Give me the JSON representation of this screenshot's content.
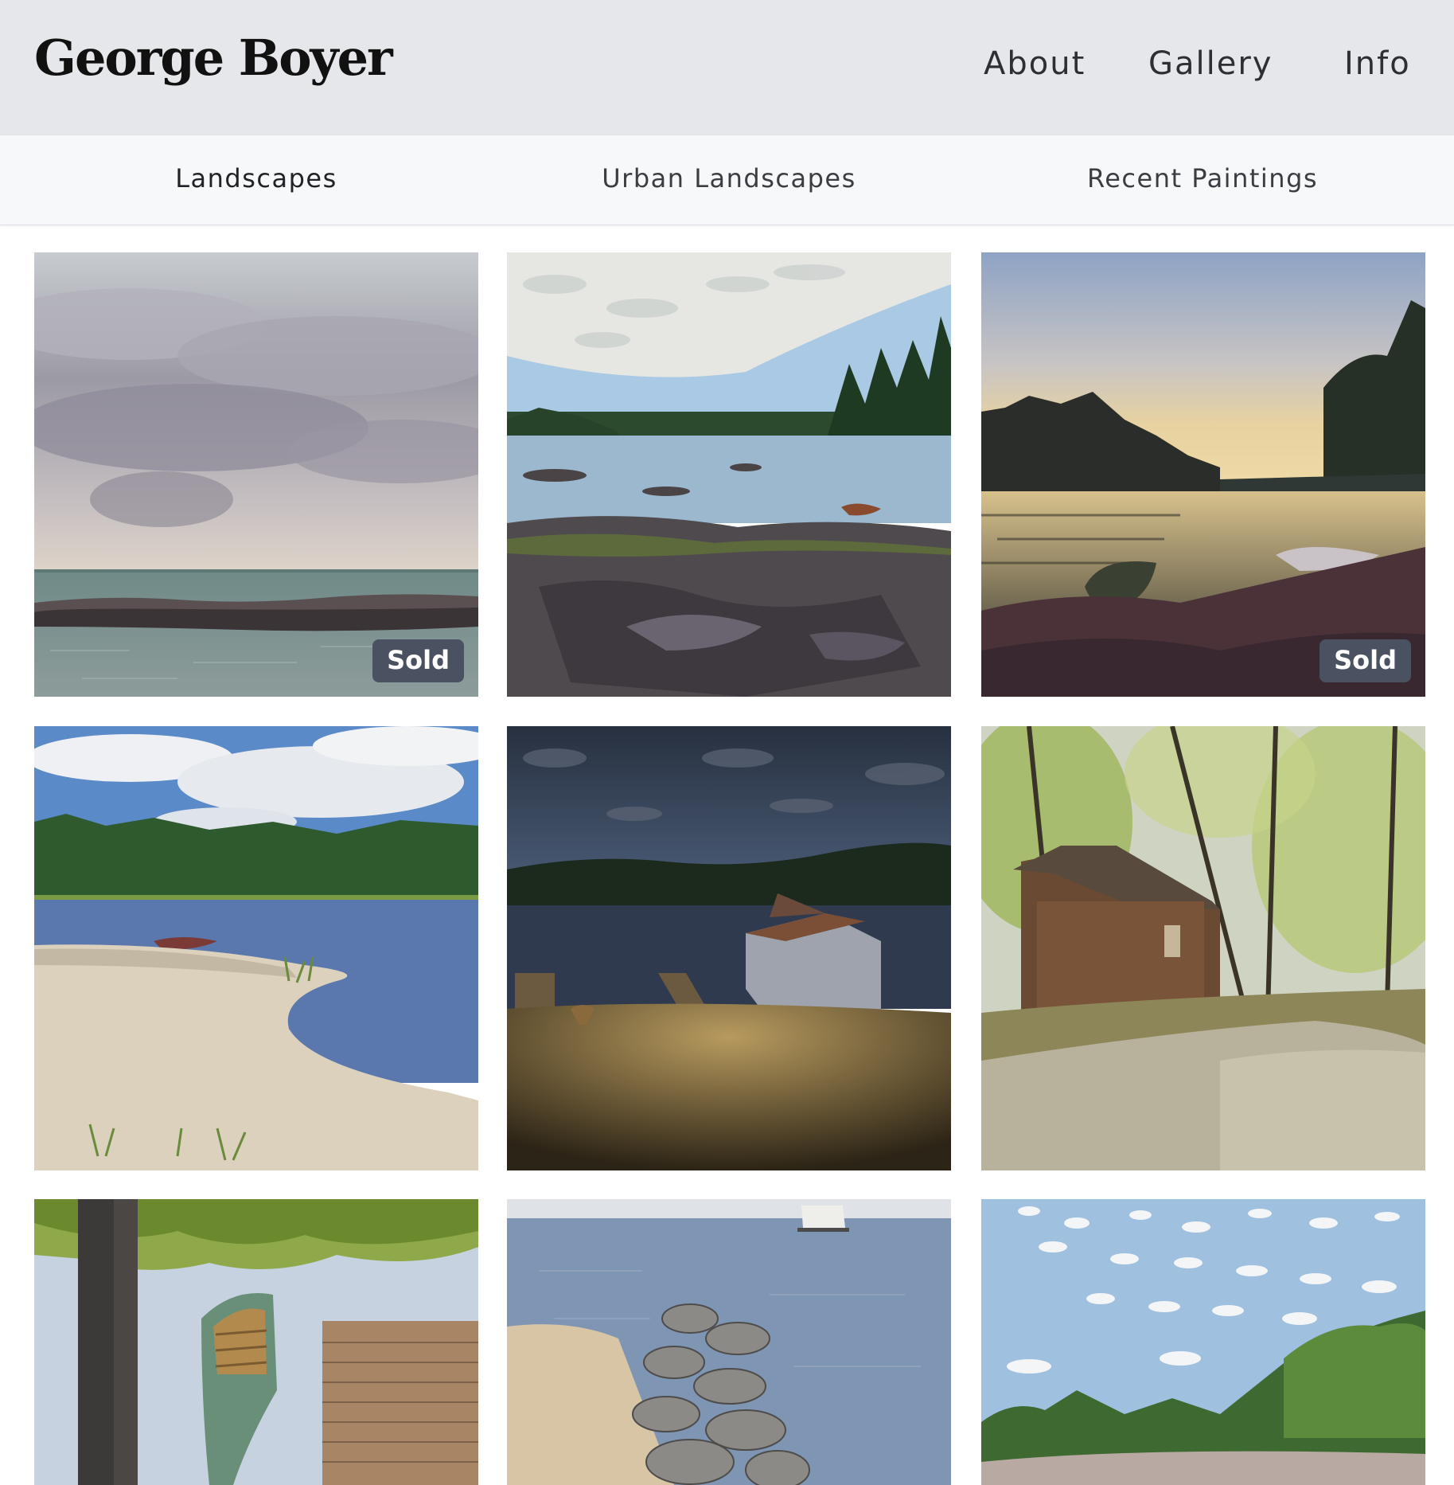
{
  "header": {
    "site_title": "George Boyer",
    "nav": [
      {
        "label": "About"
      },
      {
        "label": "Gallery"
      },
      {
        "label": "Info"
      }
    ]
  },
  "subnav": {
    "items": [
      {
        "label": "Landscapes",
        "active": true
      },
      {
        "label": "Urban Landscapes",
        "active": false
      },
      {
        "label": "Recent Paintings",
        "active": false
      }
    ]
  },
  "gallery": {
    "tiles": [
      {
        "subject": "stormy sky over lake with rock breakwater",
        "badge": "Sold"
      },
      {
        "subject": "rocky shoreline, river and spruce forest with red canoe",
        "badge": null
      },
      {
        "subject": "sunset lake with canoes on rocks",
        "badge": "Sold"
      },
      {
        "subject": "sandy point with red canoe and reeds",
        "badge": null
      },
      {
        "subject": "boathouse and docks at dusk",
        "badge": null
      },
      {
        "subject": "brown cabin among trees",
        "badge": null
      },
      {
        "subject": "green canoe beside wooden dock",
        "badge": null
      },
      {
        "subject": "rock jetty into lake with sailboat",
        "badge": null
      },
      {
        "subject": "cloudy blue sky over forested shore",
        "badge": null
      }
    ]
  },
  "colors": {
    "header_bg": "#e5e7ea",
    "subnav_bg": "#f7f8fa",
    "badge_bg": "#4a5160"
  }
}
